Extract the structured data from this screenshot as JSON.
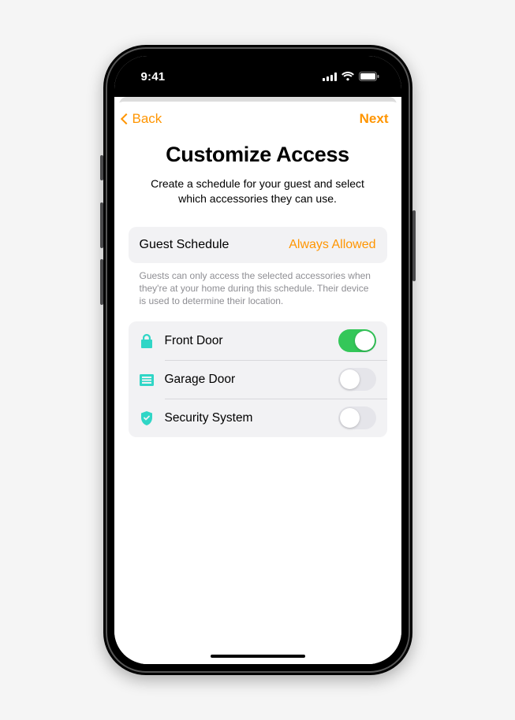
{
  "statusbar": {
    "time": "9:41"
  },
  "nav": {
    "back_label": "Back",
    "next_label": "Next"
  },
  "page": {
    "title": "Customize Access",
    "subtitle": "Create a schedule for your guest and select which accessories they can use."
  },
  "schedule": {
    "label": "Guest Schedule",
    "value": "Always Allowed",
    "footnote": "Guests can only access the selected accessories when they're at your home during this schedule. Their device is used to determine their location."
  },
  "accessories": [
    {
      "icon": "lock-icon",
      "label": "Front Door",
      "on": true
    },
    {
      "icon": "garage-door-icon",
      "label": "Garage Door",
      "on": false
    },
    {
      "icon": "shield-check-icon",
      "label": "Security System",
      "on": false
    }
  ],
  "colors": {
    "accent": "#ff9500",
    "toggle_on": "#34c759",
    "icon_teal": "#30d6c6"
  }
}
